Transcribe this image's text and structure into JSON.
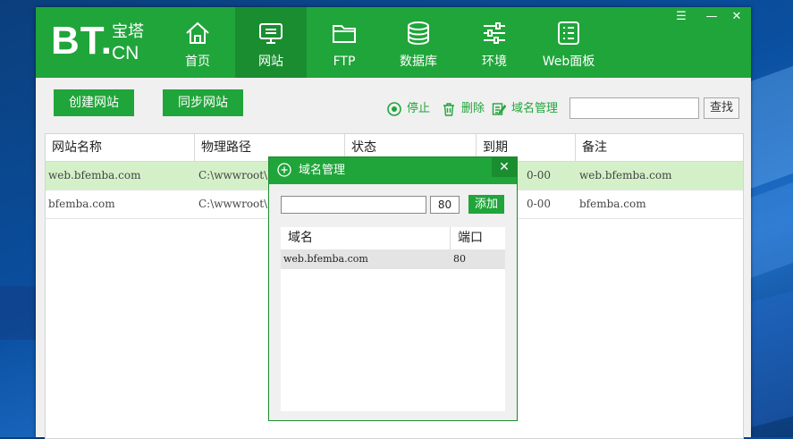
{
  "window": {
    "logo": {
      "main": "BT.",
      "sub_top": "宝塔",
      "sub_bottom": "CN"
    },
    "controls": {
      "menu": "☰",
      "minimize": "—",
      "close": "✕"
    }
  },
  "nav": [
    {
      "label": "首页",
      "icon": "home-icon",
      "active": false
    },
    {
      "label": "网站",
      "icon": "monitor-icon",
      "active": true
    },
    {
      "label": "FTP",
      "icon": "folder-icon",
      "active": false
    },
    {
      "label": "数据库",
      "icon": "database-icon",
      "active": false
    },
    {
      "label": "环境",
      "icon": "sliders-icon",
      "active": false
    },
    {
      "label": "Web面板",
      "icon": "list-icon",
      "active": false
    }
  ],
  "toolbar": {
    "create_site": "创建网站",
    "sync_site": "同步网站",
    "stop": "停止",
    "delete": "删除",
    "domain_manage": "域名管理",
    "search_value": "",
    "search_button": "查找"
  },
  "table": {
    "columns": [
      "网站名称",
      "物理路径",
      "状态",
      "到期",
      "备注"
    ],
    "rows": [
      {
        "name": "web.bfemba.com",
        "path": "C:\\wwwroot\\",
        "status": "",
        "expire": "0-00",
        "note": "web.bfemba.com",
        "selected": true
      },
      {
        "name": "bfemba.com",
        "path": "C:\\wwwroot\\",
        "status": "",
        "expire": "0-00",
        "note": "bfemba.com",
        "selected": false
      }
    ]
  },
  "dialog": {
    "title": "域名管理",
    "close": "✕",
    "domain_value": "",
    "port_value": "80",
    "add_button": "添加",
    "columns": [
      "域名",
      "端口"
    ],
    "rows": [
      {
        "domain": "web.bfemba.com",
        "port": "80"
      }
    ]
  },
  "colors": {
    "brand_green": "#20a53a",
    "active_nav": "#1a8d31",
    "selected_row": "#d4f0c8"
  }
}
